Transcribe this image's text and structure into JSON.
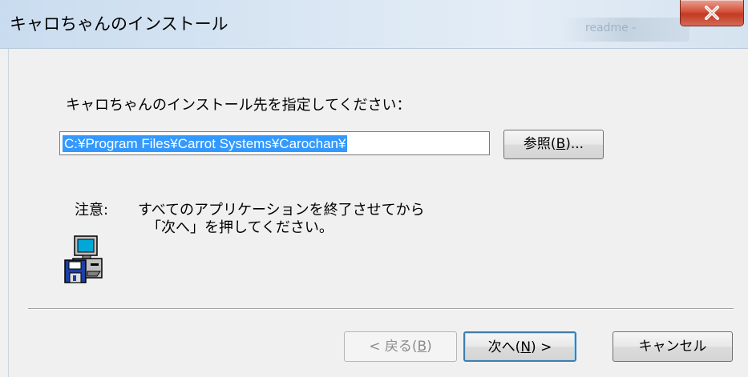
{
  "window": {
    "title": "キャロちゃんのインストール",
    "background_window_text": "readme -"
  },
  "dialog": {
    "prompt": "キャロちゃんのインストール先を指定してください：",
    "install_path": "C:¥Program Files¥Carrot Systems¥Carochan¥",
    "browse_label_prefix": "参照(",
    "browse_label_key": "B",
    "browse_label_suffix": ")...",
    "note_label": "注意:",
    "note_line1": "すべてのアプリケーションを終了させてから",
    "note_line2": "「次へ」を押してください。"
  },
  "buttons": {
    "back_prefix": "< 戻る(",
    "back_key": "B",
    "back_suffix": ")",
    "next_prefix": "次へ(",
    "next_key": "N",
    "next_suffix": ") >",
    "cancel": "キャンセル"
  },
  "icons": {
    "close": "close-icon",
    "installer": "computer-floppy-icon"
  },
  "colors": {
    "close_button": "#c9452d",
    "selection": "#3399ff",
    "titlebar": "#d7e4f2"
  }
}
